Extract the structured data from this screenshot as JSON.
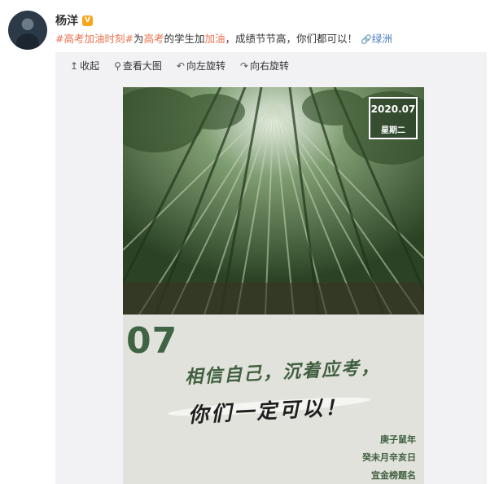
{
  "user": {
    "name": "杨洋",
    "verified_badge": "V"
  },
  "post": {
    "topic": "#高考加油时刻#",
    "text_1": "为",
    "hl_1": "高考",
    "text_2": "的学生加",
    "hl_2": "加油",
    "text_3": "，成绩节节高，你们都可以！",
    "location": "绿洲"
  },
  "toolbar": {
    "collapse": "收起",
    "view_large": "查看大图",
    "rotate_left": "向左旋转",
    "rotate_right": "向右旋转"
  },
  "poster": {
    "date_year_month": "2020.07",
    "weekday": "星期二",
    "day": "07",
    "slogan_line1": "相信自己，沉着应考，",
    "slogan_line2": "你们一定可以！",
    "lunar_year": "庚子鼠年",
    "lunar_date": "癸未月辛亥日",
    "auspicious": "宜金榜题名"
  },
  "colors": {
    "accent_orange": "#eb7350",
    "link_blue": "#4a7fc1",
    "poster_green": "#3f6443",
    "poster_bg": "#e2e2dc"
  }
}
